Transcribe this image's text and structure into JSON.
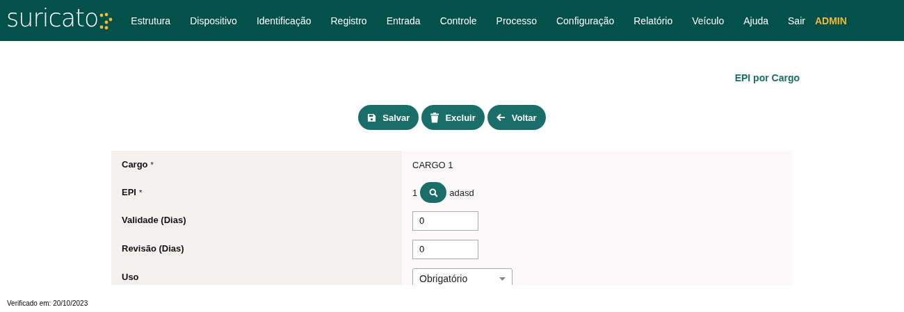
{
  "header": {
    "logo": "suricato",
    "menu": [
      {
        "label": "Estrutura",
        "kind": "link"
      },
      {
        "label": "Dispositivo",
        "kind": "link"
      },
      {
        "label": "Identificação",
        "kind": "link"
      },
      {
        "label": "Registro",
        "kind": "link"
      },
      {
        "label": "Entrada",
        "kind": "link"
      },
      {
        "label": "Controle",
        "kind": "link"
      },
      {
        "label": "Processo",
        "kind": "link"
      },
      {
        "label": "Configuração",
        "kind": "link"
      },
      {
        "label": "Relatório",
        "kind": "link"
      },
      {
        "label": "Veículo",
        "kind": "link"
      },
      {
        "label": "Ajuda",
        "kind": "link"
      },
      {
        "label": "Sair",
        "kind": "link"
      },
      {
        "label": "ADMIN",
        "kind": "user"
      }
    ]
  },
  "page_title": "EPI por Cargo",
  "buttons": [
    {
      "label": "Salvar",
      "kind": "save"
    },
    {
      "label": "Excluir",
      "kind": "delete"
    },
    {
      "label": "Voltar",
      "kind": "back"
    }
  ],
  "form": [
    {
      "label": "Cargo",
      "required_mark": "*",
      "kind": "text",
      "value": "CARGO 1"
    },
    {
      "label": "EPI",
      "required_mark": "*",
      "kind": "lookup",
      "code": "1",
      "value": "adasd"
    },
    {
      "label": "Validade (Dias)",
      "kind": "input",
      "value": "0"
    },
    {
      "label": "Revisão (Dias)",
      "kind": "input",
      "value": "0"
    },
    {
      "label": "Uso",
      "kind": "select",
      "value": "Obrigatório"
    }
  ],
  "footer": "Verificado em: 20/10/2023"
}
